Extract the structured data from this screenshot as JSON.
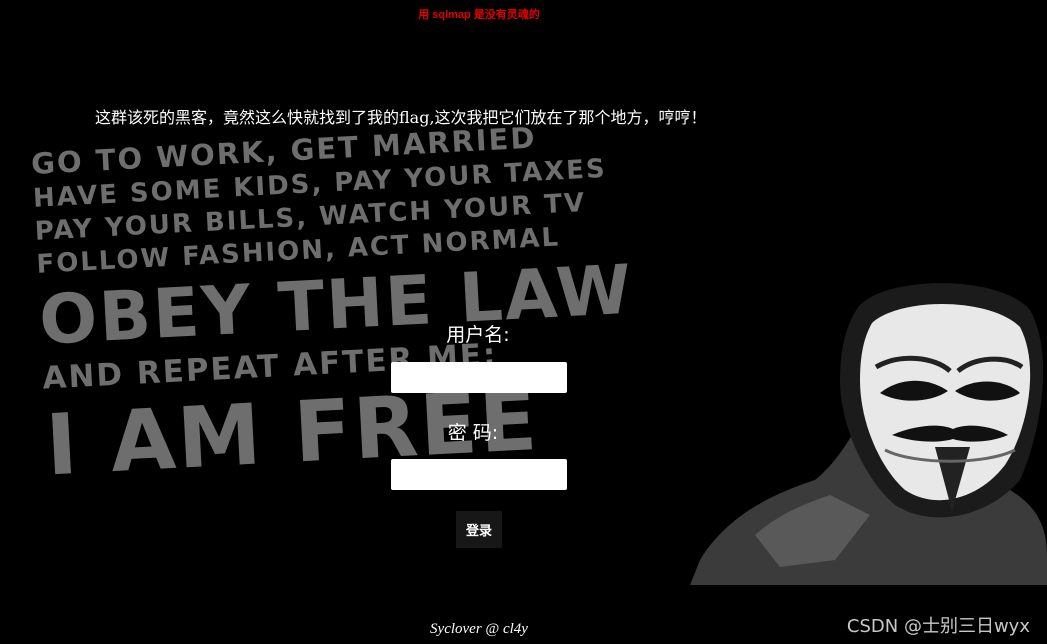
{
  "top_note": {
    "text": "用 sqlmap 是没有灵魂的",
    "color": "#e00000"
  },
  "headline": "这群该死的黑客，竟然这么快就找到了我的flag,这次我把它们放在了那个地方，哼哼！",
  "background_text": {
    "line1": "GO TO WORK, GET MARRIED",
    "line2": "HAVE SOME KIDS, PAY YOUR TAXES",
    "line3": "PAY YOUR BILLS, WATCH YOUR TV",
    "line4": "FOLLOW FASHION, ACT NORMAL",
    "line5": "OBEY THE LAW",
    "line6": "AND REPEAT AFTER ME:",
    "line7": "I AM FREE"
  },
  "form": {
    "username_label": "用户名:",
    "username_value": "",
    "password_label": "密 码:",
    "password_value": "",
    "submit_label": "登录"
  },
  "footer": "Syclover @ cl4y",
  "watermark": "CSDN @士别三日wyx",
  "decoration": {
    "mask_icon": "guy-fawkes-mask-icon"
  }
}
